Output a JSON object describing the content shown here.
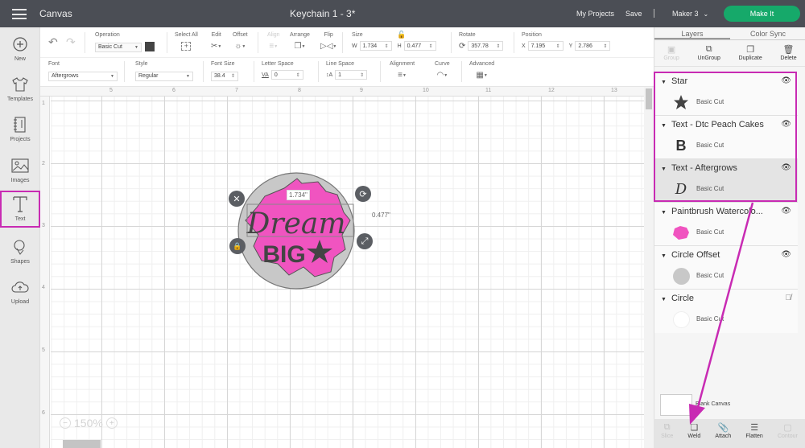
{
  "topbar": {
    "app_title": "Canvas",
    "doc_title": "Keychain 1 - 3*",
    "my_projects": "My Projects",
    "save": "Save",
    "machine": "Maker 3",
    "make_it": "Make It",
    "make_it_color": "#16a96a"
  },
  "sidebar": {
    "items": [
      {
        "label": "New",
        "icon": "plus-circle-icon"
      },
      {
        "label": "Templates",
        "icon": "tshirt-icon"
      },
      {
        "label": "Projects",
        "icon": "notebook-icon"
      },
      {
        "label": "Images",
        "icon": "image-icon"
      },
      {
        "label": "Text",
        "icon": "text-t-icon",
        "active": true
      },
      {
        "label": "Shapes",
        "icon": "shapes-icon"
      },
      {
        "label": "Upload",
        "icon": "cloud-upload-icon"
      }
    ]
  },
  "toolbar": {
    "operation_label": "Operation",
    "operation_value": "Basic Cut",
    "select_all": "Select All",
    "edit": "Edit",
    "offset": "Offset",
    "align": "Align",
    "arrange": "Arrange",
    "flip": "Flip",
    "size_label": "Size",
    "w_label": "W",
    "w_value": "1.734",
    "h_label": "H",
    "h_value": "0.477",
    "rotate_label": "Rotate",
    "rotate_value": "357.78",
    "position_label": "Position",
    "x_label": "X",
    "x_value": "7.195",
    "y_label": "Y",
    "y_value": "2.786"
  },
  "text_toolbar": {
    "font_label": "Font",
    "font_value": "Aftergrows",
    "style_label": "Style",
    "style_value": "Regular",
    "font_size_label": "Font Size",
    "font_size_value": "38.4",
    "letter_space_label": "Letter Space",
    "letter_space_value": "0",
    "line_space_label": "Line Space",
    "line_space_value": "1",
    "alignment_label": "Alignment",
    "curve_label": "Curve",
    "advanced_label": "Advanced"
  },
  "ruler": {
    "top": [
      "5",
      "6",
      "7",
      "8",
      "9",
      "10",
      "11",
      "12",
      "13"
    ],
    "left": [
      "1",
      "2",
      "3",
      "4",
      "5",
      "6"
    ]
  },
  "canvas": {
    "zoom": "150%",
    "width_readout": "1.734\"",
    "height_readout": "0.477\"",
    "design_text_line1": "Dream",
    "design_text_line2": "BIG",
    "pink": "#f054c0",
    "gray": "#c8c8c8"
  },
  "panel": {
    "tabs": [
      "Layers",
      "Color Sync"
    ],
    "actions": [
      {
        "label": "Group",
        "disabled": true
      },
      {
        "label": "UnGroup",
        "disabled": false
      },
      {
        "label": "Duplicate",
        "disabled": false
      },
      {
        "label": "Delete",
        "disabled": false
      }
    ],
    "layers": [
      {
        "title": "Star",
        "op": "Basic Cut",
        "visible": true
      },
      {
        "title": "Text - Dtc Peach Cakes",
        "op": "Basic Cut",
        "visible": true
      },
      {
        "title": "Text - Aftergrows",
        "op": "Basic Cut",
        "visible": true
      },
      {
        "title": "Paintbrush Watercolo...",
        "op": "Basic Cut",
        "visible": true
      },
      {
        "title": "Circle Offset",
        "op": "Basic Cut",
        "visible": true
      },
      {
        "title": "Circle",
        "op": "Basic Cut",
        "visible": false
      }
    ],
    "blank_canvas": "Blank Canvas",
    "bottom_tools": [
      {
        "label": "Slice",
        "disabled": true
      },
      {
        "label": "Weld",
        "disabled": false
      },
      {
        "label": "Attach",
        "disabled": false
      },
      {
        "label": "Flatten",
        "disabled": false
      },
      {
        "label": "Contour",
        "disabled": true
      }
    ],
    "highlight_color": "#c82bb3"
  }
}
